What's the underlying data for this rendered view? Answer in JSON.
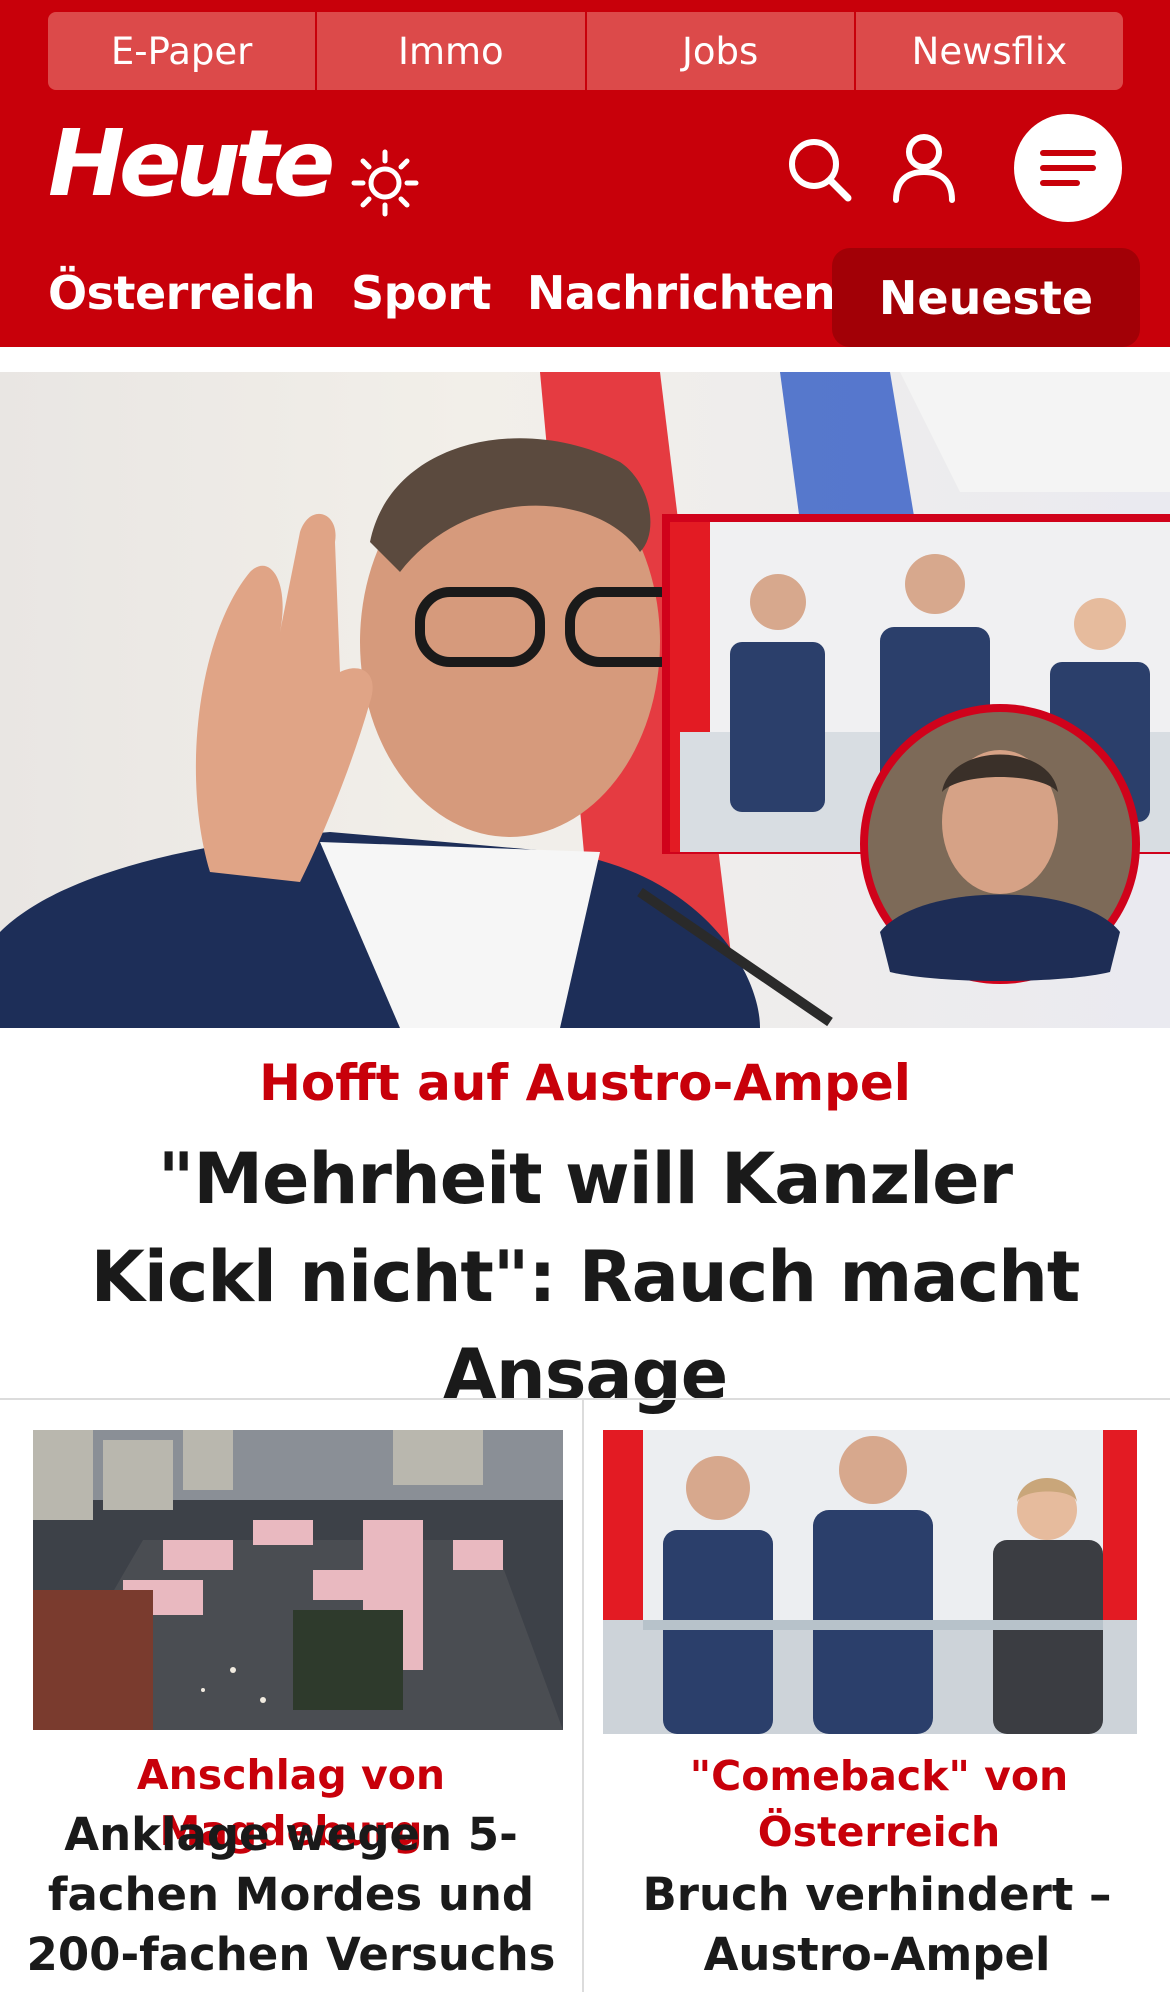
{
  "top_links": [
    "E-Paper",
    "Immo",
    "Jobs",
    "Newsflix"
  ],
  "brand": {
    "logo": "Heute"
  },
  "nav": {
    "items": [
      "Österreich",
      "Sport",
      "Nachrichten"
    ],
    "active": "Neueste"
  },
  "hero": {
    "kicker": "Hofft auf Austro-Ampel",
    "title": "\"Mehrheit will Kanzler Kickl nicht\": Rauch macht Ansage"
  },
  "cards": [
    {
      "kicker": "Anschlag von Magdeburg",
      "title": "Anklage wegen 5-fachen Mordes und 200-fachen Versuchs"
    },
    {
      "kicker": "\"Comeback\" von Österreich",
      "title": "Bruch verhindert – Austro-Ampel"
    }
  ],
  "colors": {
    "brand_red": "#c8000a",
    "link_bg": "#dc4a4a",
    "active_tab": "#a20006"
  },
  "icons": [
    "sun-icon",
    "search-icon",
    "user-icon",
    "menu-icon"
  ]
}
